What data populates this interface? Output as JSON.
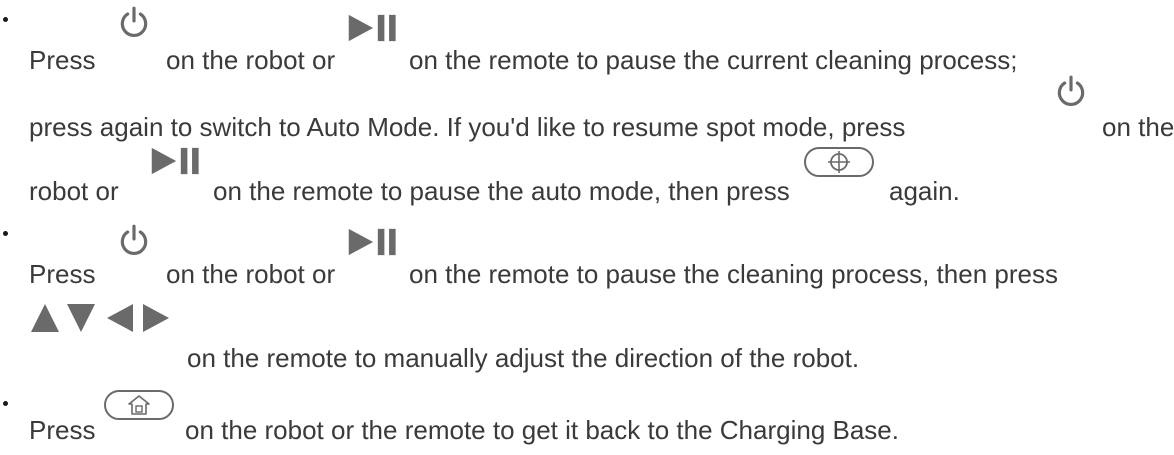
{
  "instructions": [
    {
      "lines": [
        {
          "a": "Press",
          "b": "on the robot or",
          "c": "on the remote to pause the current cleaning process;"
        },
        {
          "a": "press again to switch to Auto Mode. If you'd like to resume spot mode, press",
          "b": "on the"
        },
        {
          "a": "robot or",
          "b": "on the remote to pause the auto mode, then press",
          "c": "again."
        }
      ]
    },
    {
      "lines": [
        {
          "a": "Press",
          "b": "on the robot or",
          "c": "on the remote to pause the cleaning process, then press"
        },
        {
          "a": "on the remote to manually adjust the direction of the robot."
        }
      ]
    },
    {
      "lines": [
        {
          "a": "Press",
          "b": "on the robot or the remote to get it back to the Charging Base."
        }
      ]
    }
  ],
  "icons": {
    "power": "power-icon",
    "play_pause": "play-pause-icon",
    "spot": "spot-mode-button-icon",
    "arrows": "direction-arrows-icon",
    "home": "home-button-icon"
  },
  "colors": {
    "text": "#3a3a3a",
    "icon": "#6a6a6a",
    "bullet": "#1a1a1a"
  }
}
